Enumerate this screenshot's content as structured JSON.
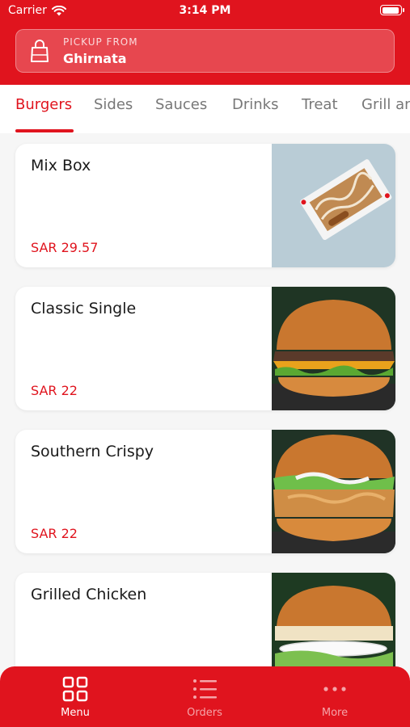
{
  "status_bar": {
    "carrier": "Carrier",
    "time": "3:14 PM"
  },
  "pickup": {
    "label": "PICKUP FROM",
    "location": "Ghirnata"
  },
  "tabs": [
    {
      "label": "Burgers",
      "active": true
    },
    {
      "label": "Sides",
      "active": false
    },
    {
      "label": "Sauces",
      "active": false
    },
    {
      "label": "Drinks",
      "active": false
    },
    {
      "label": "Treat",
      "active": false
    },
    {
      "label": "Grill and",
      "active": false
    }
  ],
  "menu_items": [
    {
      "name": "Mix Box",
      "price": "SAR 29.57"
    },
    {
      "name": "Classic Single",
      "price": "SAR 22"
    },
    {
      "name": "Southern Crispy",
      "price": "SAR 22"
    },
    {
      "name": "Grilled Chicken",
      "price": ""
    }
  ],
  "bottom_nav": [
    {
      "label": "Menu",
      "icon": "grid-icon",
      "active": true
    },
    {
      "label": "Orders",
      "icon": "list-icon",
      "active": false
    },
    {
      "label": "More",
      "icon": "more-dots-icon",
      "active": false
    }
  ],
  "colors": {
    "brand": "#e0141e",
    "price": "#e0141e",
    "nav_inactive": "#f5a4a8"
  }
}
